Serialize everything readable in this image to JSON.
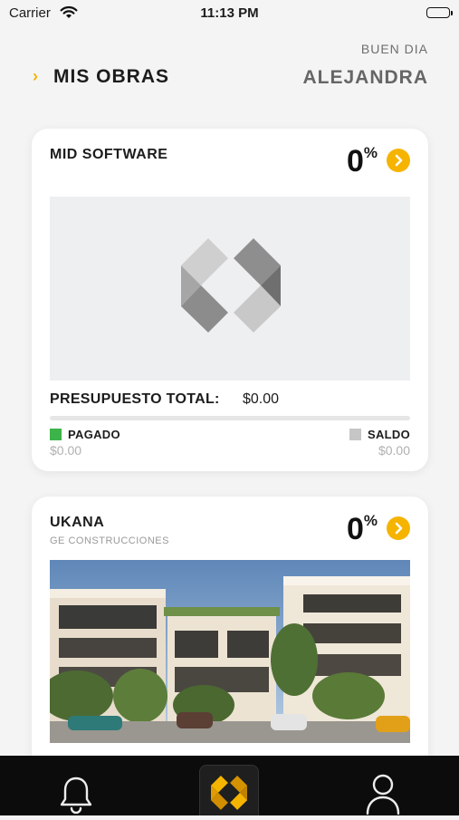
{
  "status_bar": {
    "carrier": "Carrier",
    "time": "11:13 PM"
  },
  "header": {
    "greeting": "BUEN DIA",
    "user_name": "ALEJANDRA",
    "title": "MIS OBRAS"
  },
  "projects": [
    {
      "name": "MID SOFTWARE",
      "progress_value": "0",
      "progress_unit": "%",
      "budget_label": "PRESUPUESTO TOTAL:",
      "budget_value": "$0.00",
      "paid_label": "PAGADO",
      "paid_value": "$0.00",
      "balance_label": "SALDO",
      "balance_value": "$0.00",
      "paid_fraction": 0
    },
    {
      "name": "UKANA",
      "company": "GE CONSTRUCCIONES",
      "progress_value": "0",
      "progress_unit": "%"
    }
  ],
  "tab_bar": {
    "items": [
      "bell-icon",
      "logo-icon",
      "profile-icon"
    ]
  },
  "colors": {
    "accent": "#f5b400",
    "paid": "#3cb44a",
    "balance": "#c6c6c6",
    "tab_bar": "#0c0c0c"
  }
}
